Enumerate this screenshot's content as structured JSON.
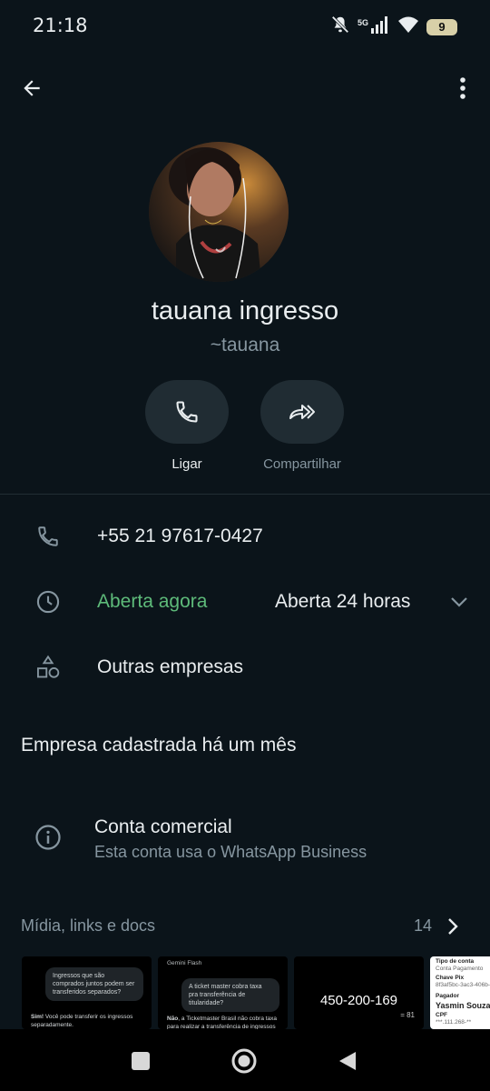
{
  "status_bar": {
    "time": "21:18",
    "network": "5G",
    "battery": "9"
  },
  "icons": {
    "back": "arrow-left-icon",
    "menu": "more-vert-icon",
    "call": "phone-icon",
    "share": "forward-icon",
    "clock": "clock-icon",
    "shapes": "shapes-icon",
    "info": "info-icon",
    "chevron_down": "chevron-down-icon",
    "chevron_right": "chevron-right-icon"
  },
  "profile": {
    "name": "tauana ingresso",
    "username": "~tauana"
  },
  "actions": {
    "call_label": "Ligar",
    "share_label": "Compartilhar"
  },
  "info": {
    "phone": "+55 21 97617-0427",
    "open_status": "Aberta agora",
    "hours": "Aberta 24 horas",
    "other_businesses": "Outras empresas"
  },
  "registered": "Empresa cadastrada há um mês",
  "business_account": {
    "title": "Conta comercial",
    "subtitle": "Esta conta usa o WhatsApp Business"
  },
  "media": {
    "title": "Mídia, links e docs",
    "count": "14",
    "thumb1": {
      "bubble": "Ingressos que são comprados juntos podem ser transferidos separados?",
      "answer_bold": "Sim!",
      "answer": "Você pode transferir os ingressos separadamente."
    },
    "thumb2": {
      "header": "Gemini Flash",
      "bubble": "A ticket master cobra taxa pra transferência de titularidade?",
      "answer_bold": "Não",
      "answer": ", a Ticketmaster Brasil não cobra taxa para realizar a transferência de ingressos"
    },
    "thumb3": {
      "number": "450-200-169",
      "small": "= 81"
    },
    "thumb4": {
      "line1": "Tipo de conta",
      "line2": "Conta Pagamento",
      "line3": "Chave Pix",
      "line4": "8f3af5bc-3ac3-406b-8",
      "line5": "Pagador",
      "line6": "Yasmin Souza S",
      "line7": "CPF",
      "line8": "***.111.268-**"
    }
  },
  "colors": {
    "background": "#0b141a",
    "accent_green": "#5ebb7a",
    "secondary_text": "#8696a0",
    "button_bg": "#202c33"
  }
}
